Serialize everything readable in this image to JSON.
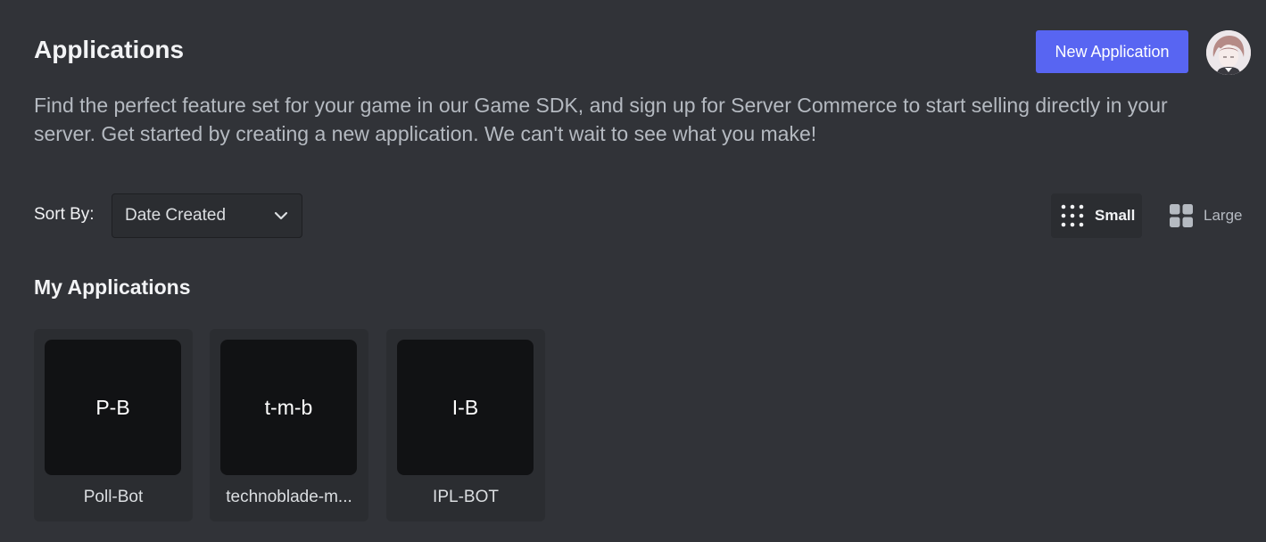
{
  "header": {
    "title": "Applications",
    "new_app_label": "New Application",
    "avatar_icon": "user-avatar"
  },
  "description": "Find the perfect feature set for your game in our Game SDK, and sign up for Server Commerce to start selling directly in your server. Get started by creating a new application. We can't wait to see what you make!",
  "sort": {
    "label": "Sort By:",
    "selected": "Date Created",
    "icon": "chevron-down-icon"
  },
  "view_toggle": {
    "small_label": "Small",
    "large_label": "Large",
    "selected": "Small"
  },
  "section_title": "My Applications",
  "applications": [
    {
      "initials": "P-B",
      "name": "Poll-Bot"
    },
    {
      "initials": "t-m-b",
      "name": "technoblade-m..."
    },
    {
      "initials": "I-B",
      "name": "IPL-BOT"
    }
  ],
  "colors": {
    "background": "#313338",
    "card": "#2b2d31",
    "thumb": "#111214",
    "accent": "#5865f2"
  }
}
